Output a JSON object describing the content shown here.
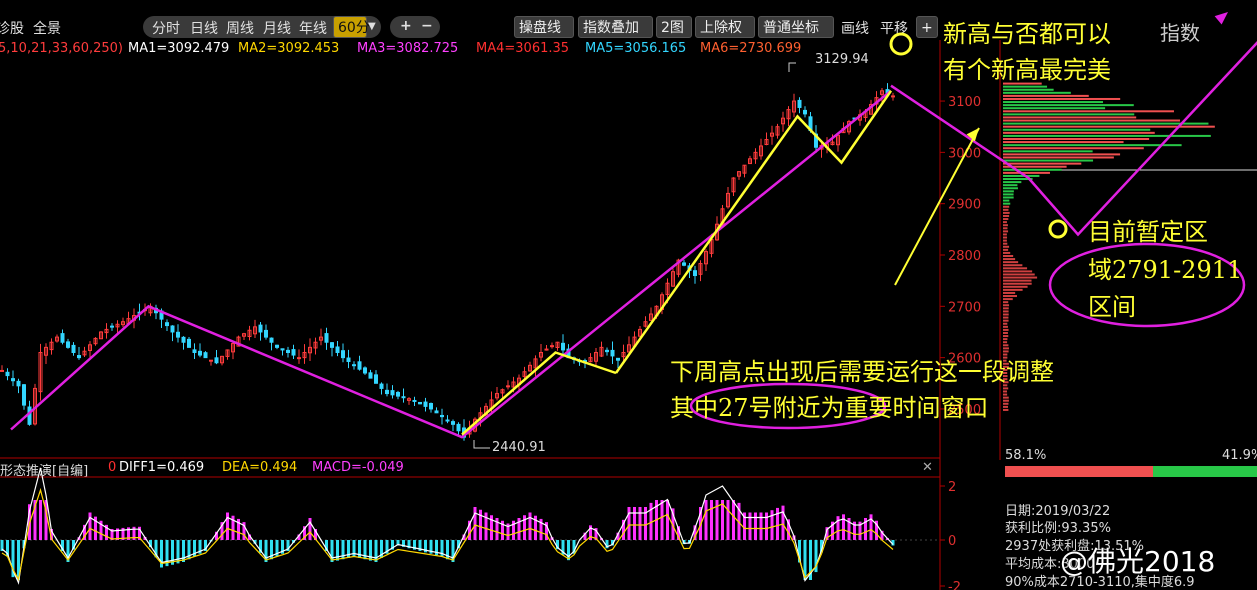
{
  "toolbar": {
    "left_labels": [
      "诊股",
      "全景"
    ],
    "periods": [
      "分时",
      "日线",
      "周线",
      "月线",
      "年线"
    ],
    "active_period": "60分",
    "zoom_plus": "+",
    "zoom_minus": "−",
    "tools": [
      "操盘线",
      "指数叠加",
      "2图",
      "上除权",
      "普通坐标"
    ],
    "extra": [
      "画线",
      "平移"
    ],
    "right_label": "指数",
    "add_label": "+"
  },
  "ma_bar": {
    "params": "5,10,21,33,60,250)",
    "ma1": "MA1=3092.479",
    "ma2": "MA2=3092.453",
    "ma3": "MA3=3082.725",
    "ma4": "MA4=3061.35",
    "ma5": "MA5=3056.165",
    "ma6": "MA6=2730.699"
  },
  "macd_bar": {
    "name": "形态推演[自编]",
    "zero": "0",
    "diff": "DIFF1=0.469",
    "dea": "DEA=0.494",
    "macd": "MACD=-0.049"
  },
  "annotations": {
    "new_high_1": "新高与否都可以",
    "new_high_2": "有个新高最完美",
    "zone_1": "目前暂定区",
    "zone_2": "域2791-2911",
    "zone_3": "区间",
    "plan_1": "下周高点出现后需要运行这一段调整",
    "plan_2": "其中27号附近为重要时间窗口",
    "high_label": "3129.94",
    "low_label": "2440.91"
  },
  "right_panel": {
    "pct_left": "58.1%",
    "pct_right": "41.9%",
    "date": "日期:2019/03/22",
    "profit_ratio": "获利比例:93.35%",
    "profit_at": "2937处获利盘:13.51%",
    "avg_cost": "平均成本:3000",
    "cost_90": "90%成本2710-3110,集中度6.9",
    "watermark": "@佛光2018"
  },
  "colors": {
    "up": "#ff3c3c",
    "down": "#33d6ff",
    "yellow": "#ffff33",
    "magenta": "#e020e0",
    "green": "#33cc66",
    "axis": "#b00000"
  },
  "chart_data": {
    "type": "candlestick",
    "y_axis_ticks": [
      2500,
      2600,
      2700,
      2800,
      2900,
      3000,
      3100
    ],
    "ylim": [
      2420,
      3180
    ],
    "macd_ticks": [
      2,
      0,
      -2
    ],
    "price_path": [
      [
        0,
        2575
      ],
      [
        3,
        2545
      ],
      [
        5,
        2470
      ],
      [
        7,
        2610
      ],
      [
        10,
        2640
      ],
      [
        14,
        2600
      ],
      [
        18,
        2650
      ],
      [
        22,
        2670
      ],
      [
        27,
        2700
      ],
      [
        31,
        2650
      ],
      [
        35,
        2610
      ],
      [
        39,
        2590
      ],
      [
        43,
        2640
      ],
      [
        46,
        2660
      ],
      [
        50,
        2620
      ],
      [
        54,
        2600
      ],
      [
        58,
        2640
      ],
      [
        62,
        2600
      ],
      [
        66,
        2570
      ],
      [
        70,
        2530
      ],
      [
        74,
        2520
      ],
      [
        78,
        2500
      ],
      [
        82,
        2470
      ],
      [
        84,
        2445
      ],
      [
        86,
        2480
      ],
      [
        90,
        2530
      ],
      [
        94,
        2560
      ],
      [
        98,
        2610
      ],
      [
        101,
        2630
      ],
      [
        103,
        2600
      ],
      [
        106,
        2590
      ],
      [
        109,
        2620
      ],
      [
        112,
        2595
      ],
      [
        115,
        2640
      ],
      [
        119,
        2700
      ],
      [
        123,
        2790
      ],
      [
        126,
        2760
      ],
      [
        129,
        2830
      ],
      [
        133,
        2950
      ],
      [
        137,
        3000
      ],
      [
        141,
        3050
      ],
      [
        144,
        3100
      ],
      [
        146,
        3075
      ],
      [
        148,
        3010
      ],
      [
        151,
        3020
      ],
      [
        154,
        3060
      ],
      [
        157,
        3080
      ],
      [
        160,
        3120
      ],
      [
        162,
        3110
      ]
    ],
    "trend_lines": [
      {
        "color": "magenta",
        "points": [
          [
            2,
            2460
          ],
          [
            27,
            2700
          ],
          [
            84,
            2445
          ],
          [
            162,
            3120
          ]
        ]
      },
      {
        "color": "magenta",
        "points": [
          [
            162,
            3130
          ],
          [
            187,
            2950
          ],
          [
            196,
            2840
          ],
          [
            230,
            3230
          ]
        ]
      },
      {
        "color": "yellow",
        "points": [
          [
            84,
            2450
          ],
          [
            101,
            2610
          ],
          [
            112,
            2570
          ]
        ]
      },
      {
        "color": "yellow",
        "points": [
          [
            112,
            2570
          ],
          [
            145,
            3070
          ],
          [
            153,
            2980
          ],
          [
            162,
            3120
          ]
        ]
      }
    ],
    "chip_distribution_range": [
      2500,
      3140
    ]
  }
}
